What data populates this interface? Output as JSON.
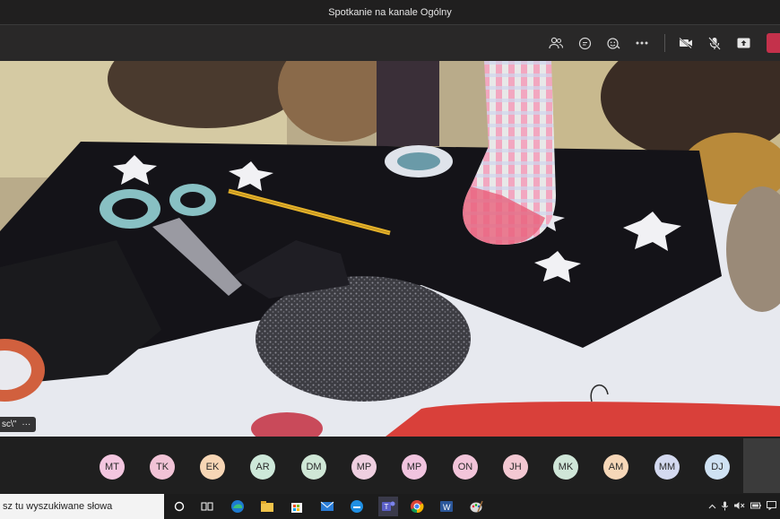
{
  "window": {
    "title": "Spotkanie na kanale Ogólny"
  },
  "toolbar": {
    "icons": [
      "participants-icon",
      "chat-icon",
      "reactions-icon",
      "more-icon",
      "camera-off-icon",
      "mic-off-icon",
      "share-icon"
    ]
  },
  "video": {
    "presenter_tag": "sc\\\"",
    "more_label": "···"
  },
  "participants": [
    {
      "initials": "MT",
      "color": "#f3c6df"
    },
    {
      "initials": "TK",
      "color": "#f1c3d6"
    },
    {
      "initials": "EK",
      "color": "#f7d6b5"
    },
    {
      "initials": "AR",
      "color": "#cde8d9"
    },
    {
      "initials": "DM",
      "color": "#cfe7d6"
    },
    {
      "initials": "MP",
      "color": "#efcfe0"
    },
    {
      "initials": "MP",
      "color": "#f1c4df"
    },
    {
      "initials": "ON",
      "color": "#f2c4d9"
    },
    {
      "initials": "JH",
      "color": "#f3c8d2"
    },
    {
      "initials": "MK",
      "color": "#cfe6d8"
    },
    {
      "initials": "AM",
      "color": "#f6d7b8"
    },
    {
      "initials": "MM",
      "color": "#d3d9ef"
    },
    {
      "initials": "DJ",
      "color": "#cfe2f3"
    }
  ],
  "taskbar": {
    "search_text": "sz tu wyszukiwane słowa",
    "apps": [
      "cortana-icon",
      "task-view-icon",
      "edge-icon",
      "file-explorer-icon",
      "store-icon",
      "mail-icon",
      "edge-legacy-icon",
      "teams-icon",
      "chrome-icon",
      "word-icon",
      "paint-icon"
    ]
  }
}
